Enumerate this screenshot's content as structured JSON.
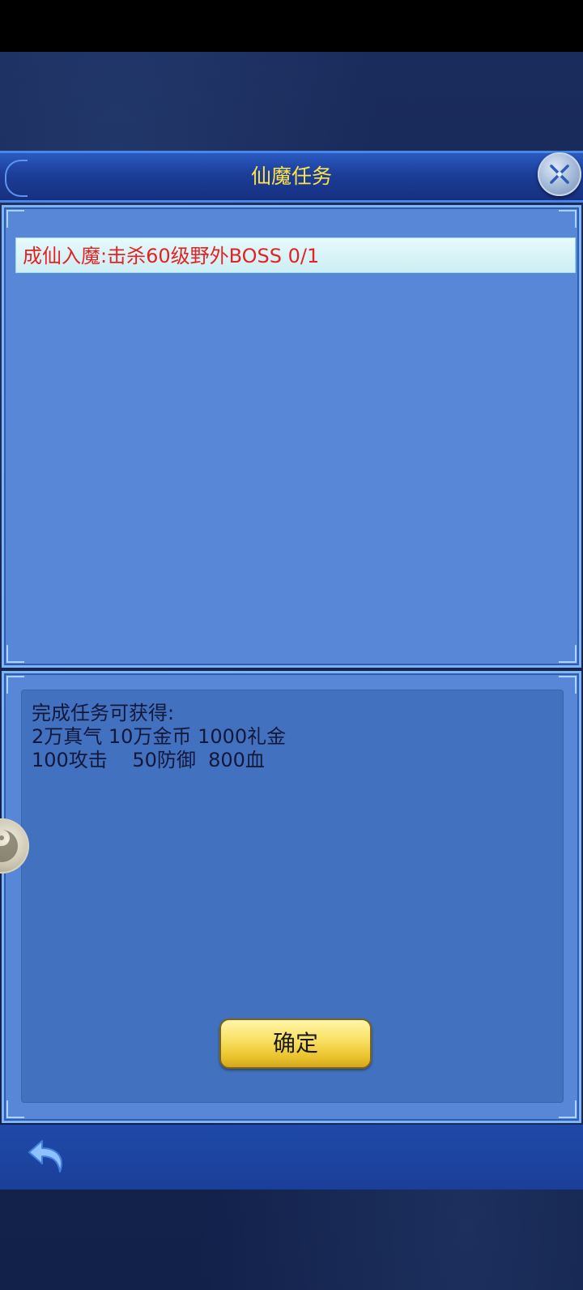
{
  "dialog": {
    "title": "仙魔任务"
  },
  "quest": {
    "text": "成仙入魔:击杀60级野外BOSS 0/1"
  },
  "reward": {
    "header": "完成任务可获得:",
    "line1": "2万真气 10万金币 1000礼金",
    "line2": "100攻击    50防御  800血"
  },
  "buttons": {
    "confirm_label": "确定"
  },
  "icons": {
    "close": "close-icon",
    "back": "back-arrow-icon",
    "side_orb": "taiji-icon"
  },
  "colors": {
    "title": "#ffe34a",
    "quest_text": "#e52222",
    "panel": "#5787d6",
    "button": "#f9e267"
  }
}
